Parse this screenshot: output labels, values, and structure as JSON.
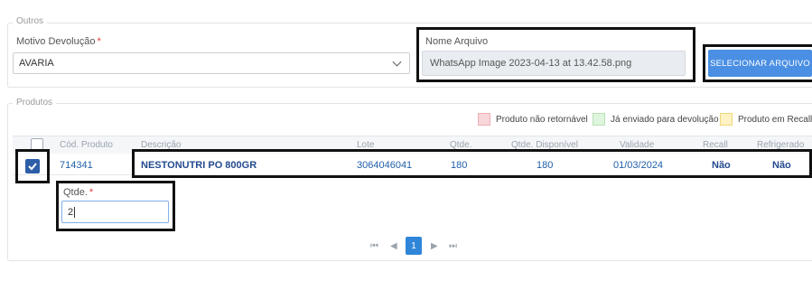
{
  "outros": {
    "legend": "Outros",
    "motivo_label": "Motivo Devolução",
    "motivo_required": "*",
    "motivo_value": "AVARIA",
    "nome_arquivo_label": "Nome Arquivo",
    "nome_arquivo_value": "WhatsApp Image 2023-04-13 at 13.42.58.png",
    "select_button": "SELECIONAR ARQUIVO"
  },
  "produtos": {
    "legend": "Produtos",
    "status_legend": [
      {
        "label": "Produto não retornável",
        "color": "#f8d7da",
        "border": "#f1aeb5"
      },
      {
        "label": "Já enviado para devolução",
        "color": "#dff5dd",
        "border": "#b8e2b3"
      },
      {
        "label": "Produto em Recall",
        "color": "#fff3c4",
        "border": "#f0d77a"
      }
    ],
    "columns": [
      "Cód. Produto",
      "Descrição",
      "Lote",
      "Qtde.",
      "Qtde. Disponível",
      "Validade",
      "Recall",
      "Refrigerado"
    ],
    "row": {
      "codigo": "714341",
      "descricao": "NESTONUTRI PO 800GR",
      "lote": "3064046041",
      "qtde": "180",
      "qtde_disponivel": "180",
      "validade": "01/03/2024",
      "recall": "Não",
      "refrigerado": "Não",
      "selected": true
    },
    "qtde_label": "Qtde.",
    "qtde_required": "*",
    "qtde_value": "2"
  },
  "pagination": {
    "first": "⏮",
    "prev": "◀",
    "current": "1",
    "next": "▶",
    "last": "⏭"
  }
}
